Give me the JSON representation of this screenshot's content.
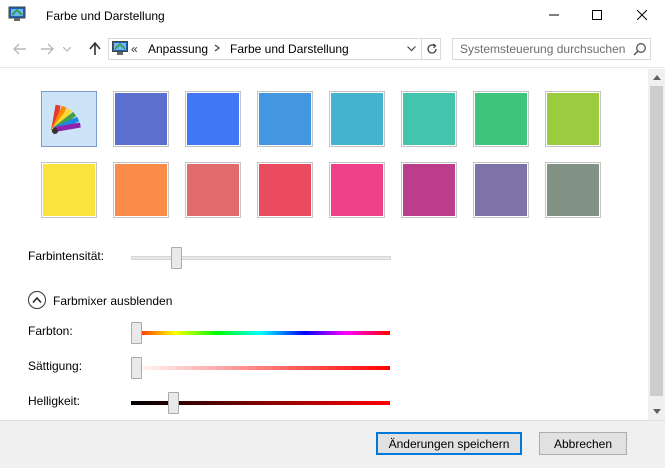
{
  "window": {
    "title": "Farbe und Darstellung",
    "controls": [
      "minimize",
      "maximize",
      "close"
    ]
  },
  "nav": {
    "breadcrumb_overflow": "«",
    "breadcrumb": [
      "Anpassung",
      "Farbe und Darstellung"
    ],
    "search_placeholder": "Systemsteuerung durchsuchen"
  },
  "color_tiles": [
    {
      "name": "Automatisch",
      "color": null,
      "icon": "color-palette-icon",
      "selected": true
    },
    {
      "color": "#5b6fcf"
    },
    {
      "color": "#3f78f2"
    },
    {
      "color": "#4397e0"
    },
    {
      "color": "#43b3cf"
    },
    {
      "color": "#42c4ad"
    },
    {
      "color": "#3fc47b"
    },
    {
      "color": "#9bcb3f"
    },
    {
      "color": "#fbe33d"
    },
    {
      "color": "#fb8b48"
    },
    {
      "color": "#e06a6c"
    },
    {
      "color": "#ea4b5e"
    },
    {
      "color": "#ee4189"
    },
    {
      "color": "#bc3d8b"
    },
    {
      "color": "#7d73a8"
    },
    {
      "color": "#829285"
    }
  ],
  "intensity": {
    "label": "Farbintensität:",
    "value": 0.16
  },
  "mixer_toggle": {
    "label": "Farbmixer ausblenden"
  },
  "mixer": {
    "hue": {
      "label": "Farbton:",
      "value": 0.0
    },
    "saturation": {
      "label": "Sättigung:",
      "value": 0.0
    },
    "brightness": {
      "label": "Helligkeit:",
      "value": 0.15
    }
  },
  "footer": {
    "save_label": "Änderungen speichern",
    "cancel_label": "Abbrechen"
  }
}
